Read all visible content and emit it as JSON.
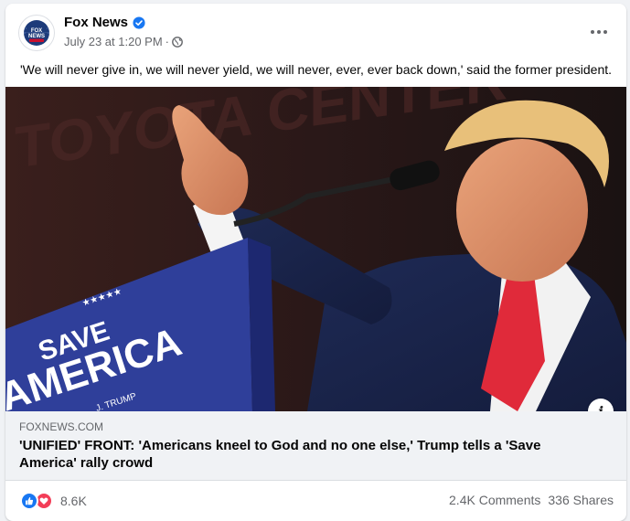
{
  "post": {
    "page_name": "Fox News",
    "timestamp": "July 23 at 1:20 PM",
    "separator": "·",
    "caption": "'We will never give in, we will never yield, we will never, ever, ever back down,' said the former president."
  },
  "image": {
    "podium_text_line1": "SAVE",
    "podium_text_line2": "AMERICA",
    "podium_text_line3": "J. TRUMP",
    "backdrop_text": "TOYOTA CENTER"
  },
  "link": {
    "domain": "FOXNEWS.COM",
    "title": "'UNIFIED' FRONT: 'Americans kneel to God and no one else,' Trump tells a 'Save America' rally crowd"
  },
  "footer": {
    "reaction_count": "8.6K",
    "comments": "2.4K Comments",
    "shares": "336 Shares"
  },
  "colors": {
    "accent_blue": "#1877f2",
    "love_red": "#f33e58",
    "podium_blue": "#2f3f9a"
  },
  "icons": {
    "verified": "verified-badge-icon",
    "audience": "globe-icon",
    "more": "more-options-icon",
    "info": "info-icon",
    "like": "like-reaction-icon",
    "love": "love-reaction-icon"
  }
}
